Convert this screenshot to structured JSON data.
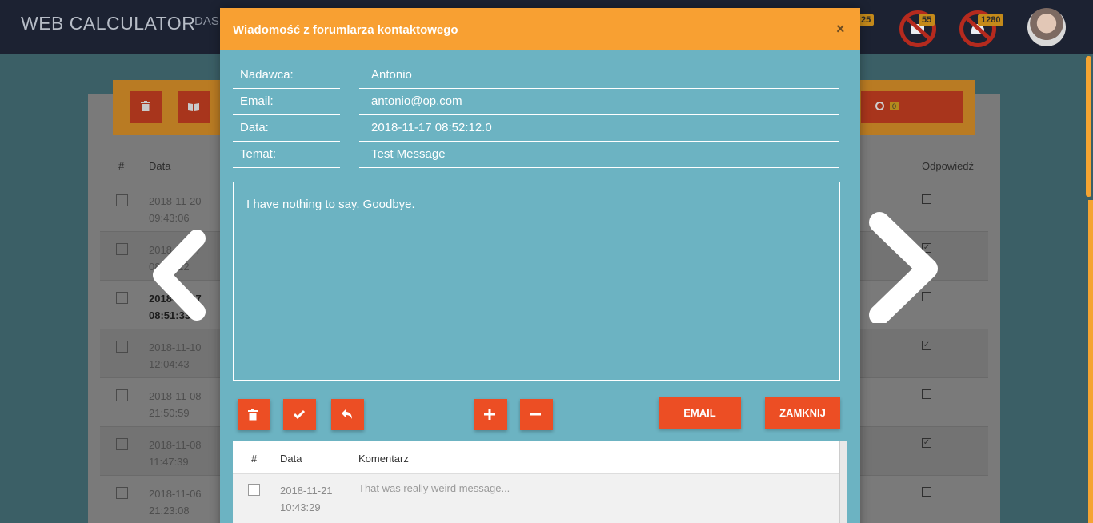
{
  "app": {
    "title": "WEB CALCULATOR",
    "nav_partial": "DAS",
    "badge_1": "25",
    "badge_2": "55",
    "badge_3": "1280"
  },
  "background_list": {
    "col_hash": "#",
    "col_date": "Data",
    "col_answer": "Odpowiedź",
    "search_count": "0",
    "rows": [
      {
        "date": "2018-11-20\n09:43:06",
        "bold": false,
        "answered": false
      },
      {
        "date": "2018-11-17\n08:52:12",
        "bold": false,
        "answered": true
      },
      {
        "date": "2018-11-17\n08:51:33",
        "bold": true,
        "answered": false
      },
      {
        "date": "2018-11-10\n12:04:43",
        "bold": false,
        "answered": true
      },
      {
        "date": "2018-11-08\n21:50:59",
        "bold": false,
        "answered": false
      },
      {
        "date": "2018-11-08\n11:47:39",
        "bold": false,
        "answered": true
      },
      {
        "date": "2018-11-06\n21:23:08",
        "bold": false,
        "answered": false
      }
    ]
  },
  "modal": {
    "title": "Wiadomość z forumlarza kontaktowego",
    "close": "×",
    "fields": [
      {
        "label": "Nadawca:",
        "value": "Antonio"
      },
      {
        "label": "Email:",
        "value": "antonio@op.com"
      },
      {
        "label": "Data:",
        "value": "2018-11-17 08:52:12.0"
      },
      {
        "label": "Temat:",
        "value": "Test Message"
      }
    ],
    "message": "I have nothing to say. Goodbye.",
    "email_button": "EMAIL",
    "close_button": "ZAMKNIJ",
    "comments": {
      "col_hash": "#",
      "col_date": "Data",
      "col_comment": "Komentarz",
      "rows": [
        {
          "date": "2018-11-21\n10:43:29",
          "comment": "That was really weird message..."
        }
      ]
    }
  },
  "colors": {
    "accent_orange": "#f8a032",
    "button_red": "#ec4e24",
    "modal_bg": "#6cb3c2",
    "topbar": "#1c2232"
  },
  "icons": [
    "trash-icon",
    "book-icon",
    "search-icon",
    "check-icon",
    "reply-icon",
    "plus-icon",
    "minus-icon",
    "chevron-left-icon",
    "chevron-right-icon",
    "close-icon"
  ]
}
